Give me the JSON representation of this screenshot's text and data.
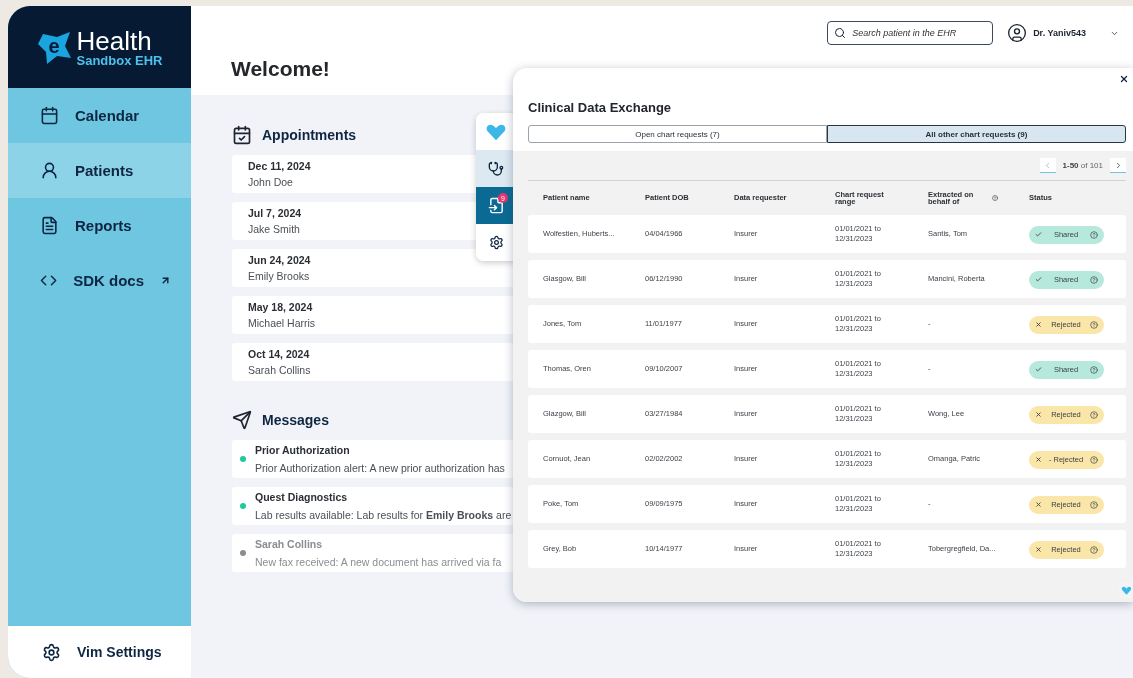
{
  "logo": {
    "mark": "e",
    "name": "Health",
    "subtitle": "Sandbox EHR"
  },
  "sidebar": {
    "items": [
      {
        "label": "Calendar",
        "kind": "calendar",
        "selected": false,
        "external": false
      },
      {
        "label": "Patients",
        "kind": "patients",
        "selected": true,
        "external": false
      },
      {
        "label": "Reports",
        "kind": "reports",
        "selected": false,
        "external": false
      },
      {
        "label": "SDK docs",
        "kind": "sdk",
        "selected": false,
        "external": true
      }
    ],
    "footer": {
      "label": "Vim Settings"
    }
  },
  "header": {
    "title": "Welcome!",
    "search": {
      "placeholder": "Search patient in the EHR"
    },
    "user": "Dr. Yaniv543"
  },
  "appointments": {
    "title": "Appointments",
    "items": [
      {
        "date": "Dec 11, 2024",
        "patient": "John Doe"
      },
      {
        "date": "Jul 7, 2024",
        "patient": "Jake Smith"
      },
      {
        "date": "Jun 24, 2024",
        "patient": "Emily Brooks"
      },
      {
        "date": "May 18, 2024",
        "patient": "Michael Harris"
      },
      {
        "date": "Oct 14, 2024",
        "patient": "Sarah Collins"
      }
    ]
  },
  "messages": {
    "title": "Messages",
    "items": [
      {
        "sender": "Prior Authorization",
        "text": "Prior Authorization alert: A new prior authorization has",
        "read": false,
        "color": "#1ec99a"
      },
      {
        "sender": "Quest Diagnostics",
        "text": "Lab results available: Lab results for **Emily Brooks** are",
        "read": false,
        "color": "#1ec99a"
      },
      {
        "sender": "Sarah Collins",
        "text": "New fax received: A new document has arrived via fa",
        "read": true,
        "color": "#8a8d92"
      }
    ]
  },
  "vim_panel": {
    "items": [
      {
        "kind": "heart",
        "selected": false,
        "highlighted": false
      },
      {
        "kind": "stethoscope",
        "selected": false,
        "highlighted": true
      },
      {
        "kind": "transfer",
        "selected": true,
        "highlighted": false,
        "badge": "9"
      },
      {
        "kind": "settings",
        "selected": false,
        "highlighted": false
      }
    ]
  },
  "modal": {
    "title": "Clinical Data Exchange",
    "tabs": [
      {
        "label": "Open chart requests (7)",
        "selected": false
      },
      {
        "label": "All other chart requests (9)",
        "selected": true
      }
    ],
    "pagination": "**1-50** of 101",
    "table": {
      "columns": [
        "Patient name",
        "Patient DOB",
        "Data requester",
        "Chart request range",
        "Extracted on behalf of",
        "Status"
      ],
      "rows": [
        {
          "name": "Wolfestien, Huberts...",
          "dob": "04/04/1966",
          "requester": "Insurer",
          "range": "01/01/2021 to 12/31/2023",
          "behalf": "Santis, Tom",
          "status": {
            "kind": "shared",
            "label": "Shared"
          }
        },
        {
          "name": "Glasgow, Bill",
          "dob": "06/12/1990",
          "requester": "Insurer",
          "range": "01/01/2021 to 12/31/2023",
          "behalf": "Mancini, Roberta",
          "status": {
            "kind": "shared",
            "label": "Shared"
          }
        },
        {
          "name": "Jones, Tom",
          "dob": "11/01/1977",
          "requester": "Insurer",
          "range": "01/01/2021 to 12/31/2023",
          "behalf": "-",
          "status": {
            "kind": "rejected",
            "label": "Rejected"
          }
        },
        {
          "name": "Thomas, Oren",
          "dob": "09/10/2007",
          "requester": "Insurer",
          "range": "01/01/2021 to 12/31/2023",
          "behalf": "-",
          "status": {
            "kind": "shared",
            "label": "Shared"
          }
        },
        {
          "name": "Glazgow, Bill",
          "dob": "03/27/1984",
          "requester": "Insurer",
          "range": "01/01/2021 to 12/31/2023",
          "behalf": "Wong, Lee",
          "status": {
            "kind": "rejected",
            "label": "Rejected"
          }
        },
        {
          "name": "Cornuot, Jean",
          "dob": "02/02/2002",
          "requester": "Insurer",
          "range": "01/01/2021 to 12/31/2023",
          "behalf": "Omanga, Patric",
          "status": {
            "kind": "rejected",
            "label": "- Rejected"
          }
        },
        {
          "name": "Poke, Tom",
          "dob": "09/09/1975",
          "requester": "Insurer",
          "range": "01/01/2021 to 12/31/2023",
          "behalf": "-",
          "status": {
            "kind": "rejected",
            "label": "Rejected"
          }
        },
        {
          "name": "Grey, Bob",
          "dob": "10/14/1977",
          "requester": "Insurer",
          "range": "01/01/2021 to 12/31/2023",
          "behalf": "Tobergregfield, Da...",
          "status": {
            "kind": "rejected",
            "label": "Rejected"
          }
        }
      ]
    }
  }
}
